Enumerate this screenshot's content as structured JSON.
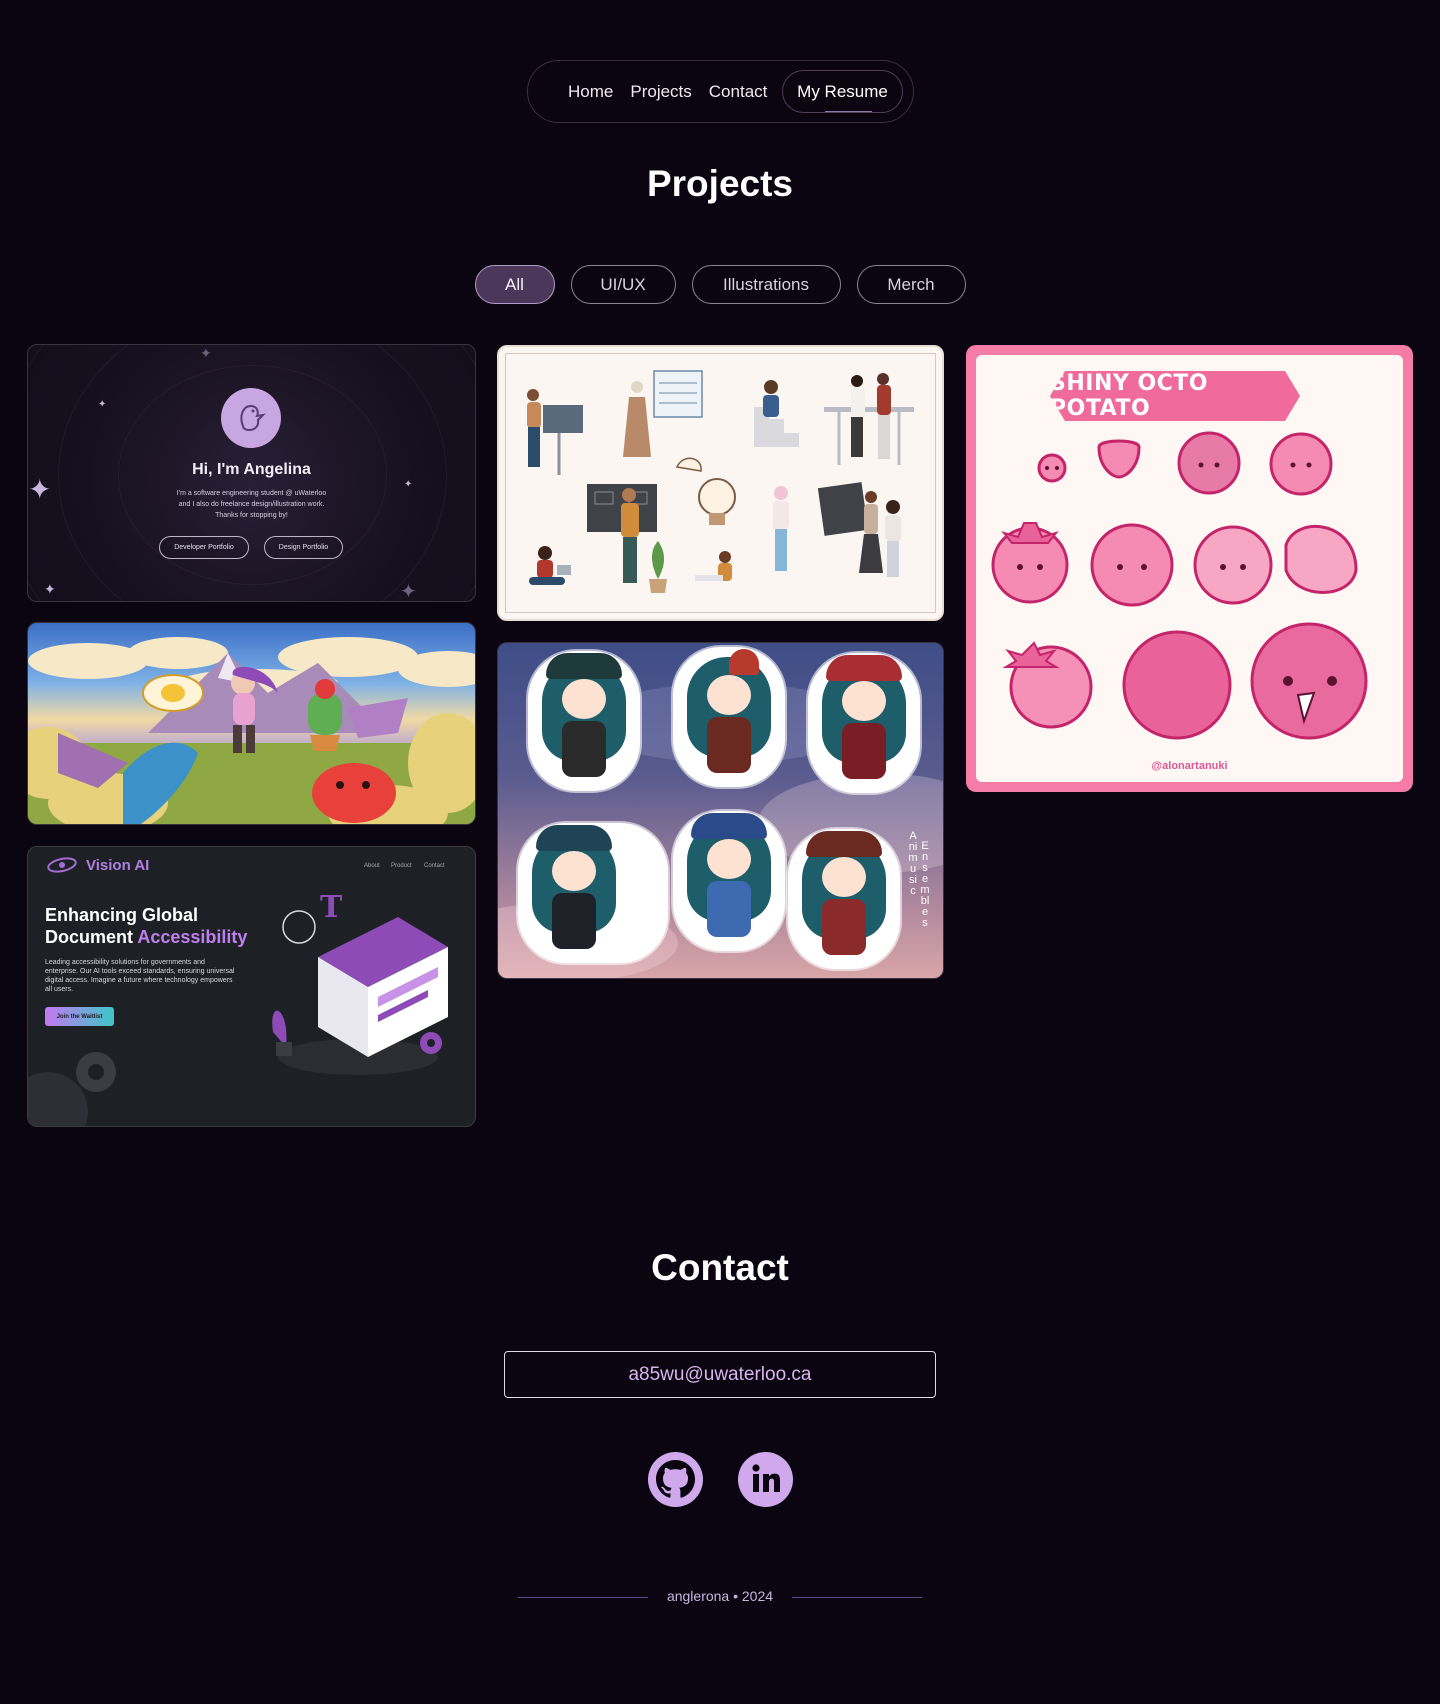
{
  "nav": {
    "links": [
      "Home",
      "Projects",
      "Contact"
    ],
    "resume_label": "My Resume"
  },
  "projects": {
    "title": "Projects",
    "filters": [
      "All",
      "UI/UX",
      "Illustrations",
      "Merch"
    ],
    "active_filter": "All"
  },
  "cards": {
    "hero": {
      "title": "Hi, I'm Angelina",
      "subtitle_lines": [
        "I'm a software engineering student @ uWaterloo",
        "and I also do freelance design/illustration work.",
        "Thanks for stopping by!"
      ],
      "buttons": [
        "Developer Portfolio",
        "Design Portfolio"
      ]
    },
    "octo": {
      "banner": "SHINY OCTO POTATO",
      "handle": "@alonartanuki"
    },
    "chars": {
      "vertical_left": "Animusic",
      "vertical_right": "Ensembles"
    },
    "vision": {
      "logo": "Vision AI",
      "nav": [
        "About",
        "Product",
        "Contact"
      ],
      "headline_1": "Enhancing Global",
      "headline_2a": "Document ",
      "headline_2b": "Accessibility",
      "paragraph": "Leading accessibility solutions for governments and enterprise. Our AI tools exceed standards, ensuring universal digital access. Imagine a future where technology empowers all users.",
      "button": "Join the Waitlist"
    }
  },
  "contact": {
    "title": "Contact",
    "email": "a85wu@uwaterloo.ca",
    "socials": [
      "github-icon",
      "linkedin-icon"
    ]
  },
  "footer": {
    "text": "anglerona • 2024"
  },
  "colors": {
    "background": "#0b0411",
    "accent": "#cfa9ec",
    "active_filter_bg": "#4a3759"
  }
}
